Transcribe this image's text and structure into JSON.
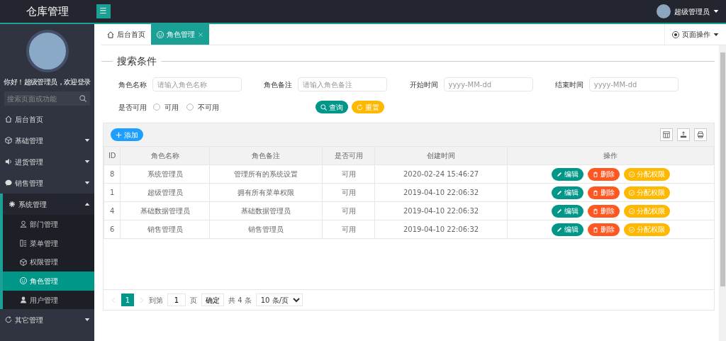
{
  "header": {
    "logo": "仓库管理",
    "menu_toggle": "☰",
    "user": "超级管理员"
  },
  "sidebar": {
    "greeting": "你好！超级管理员，欢迎登录",
    "search": {
      "placeholder": "搜索页面或功能"
    },
    "items": [
      {
        "label": "后台首页",
        "selected": false
      },
      {
        "label": "基础管理",
        "expanded": false
      },
      {
        "label": "进货管理",
        "expanded": false
      },
      {
        "label": "销售管理",
        "expanded": false
      },
      {
        "label": "系统管理",
        "expanded": true,
        "children": [
          {
            "label": "部门管理",
            "selected": false
          },
          {
            "label": "菜单管理",
            "selected": false
          },
          {
            "label": "权限管理",
            "selected": false
          },
          {
            "label": "角色管理",
            "selected": true
          },
          {
            "label": "用户管理",
            "selected": false
          }
        ]
      },
      {
        "label": "其它管理",
        "expanded": false
      }
    ]
  },
  "tabs": [
    {
      "label": "后台首页",
      "selected": false
    },
    {
      "label": "角色管理",
      "selected": true
    }
  ],
  "page_actions": "页面操作",
  "search_panel": {
    "title": "搜索条件",
    "fields": [
      {
        "label": "角色名称",
        "placeholder": "请输入角色名称"
      },
      {
        "label": "角色备注",
        "placeholder": "请输入角色备注"
      },
      {
        "label": "开始时间",
        "placeholder": "yyyy-MM-dd"
      },
      {
        "label": "结束时间",
        "placeholder": "yyyy-MM-dd"
      }
    ],
    "availability": {
      "label": "是否可用",
      "options": [
        {
          "label": "可用",
          "selected": false
        },
        {
          "label": "不可用",
          "selected": false
        }
      ]
    },
    "buttons": [
      {
        "label": "查询",
        "kind": "search"
      },
      {
        "label": "重置",
        "kind": "reset"
      }
    ]
  },
  "table": {
    "add_button": "添加",
    "columns": [
      "ID",
      "角色名称",
      "角色备注",
      "是否可用",
      "创建时间",
      "操作"
    ],
    "rows": [
      {
        "id": "8",
        "name": "系统管理员",
        "remark": "管理所有的系统设置",
        "available": "可用",
        "created": "2020-02-24 15:46:27",
        "actions": [
          {
            "label": "编辑",
            "kind": "edit"
          },
          {
            "label": "删除",
            "kind": "delete"
          },
          {
            "label": "分配权限",
            "kind": "assign"
          }
        ]
      },
      {
        "id": "1",
        "name": "超级管理员",
        "remark": "拥有所有菜单权限",
        "available": "可用",
        "created": "2019-04-10 22:06:32",
        "actions": [
          {
            "label": "编辑",
            "kind": "edit"
          },
          {
            "label": "删除",
            "kind": "delete"
          },
          {
            "label": "分配权限",
            "kind": "assign"
          }
        ]
      },
      {
        "id": "4",
        "name": "基础数据管理员",
        "remark": "基础数据管理员",
        "available": "可用",
        "created": "2019-04-10 22:06:32",
        "actions": [
          {
            "label": "编辑",
            "kind": "edit"
          },
          {
            "label": "删除",
            "kind": "delete"
          },
          {
            "label": "分配权限",
            "kind": "assign"
          }
        ]
      },
      {
        "id": "6",
        "name": "销售管理员",
        "remark": "销售管理员",
        "available": "可用",
        "created": "2019-04-10 22:06:32",
        "actions": [
          {
            "label": "编辑",
            "kind": "edit"
          },
          {
            "label": "删除",
            "kind": "delete"
          },
          {
            "label": "分配权限",
            "kind": "assign"
          }
        ]
      }
    ]
  },
  "pagination": {
    "pages": [
      {
        "label": "1",
        "selected": true
      }
    ],
    "goto_label": "到第",
    "goto_value": "1",
    "page_unit": "页",
    "confirm": "确定",
    "total": "共 4 条",
    "page_size": "10 条/页"
  }
}
